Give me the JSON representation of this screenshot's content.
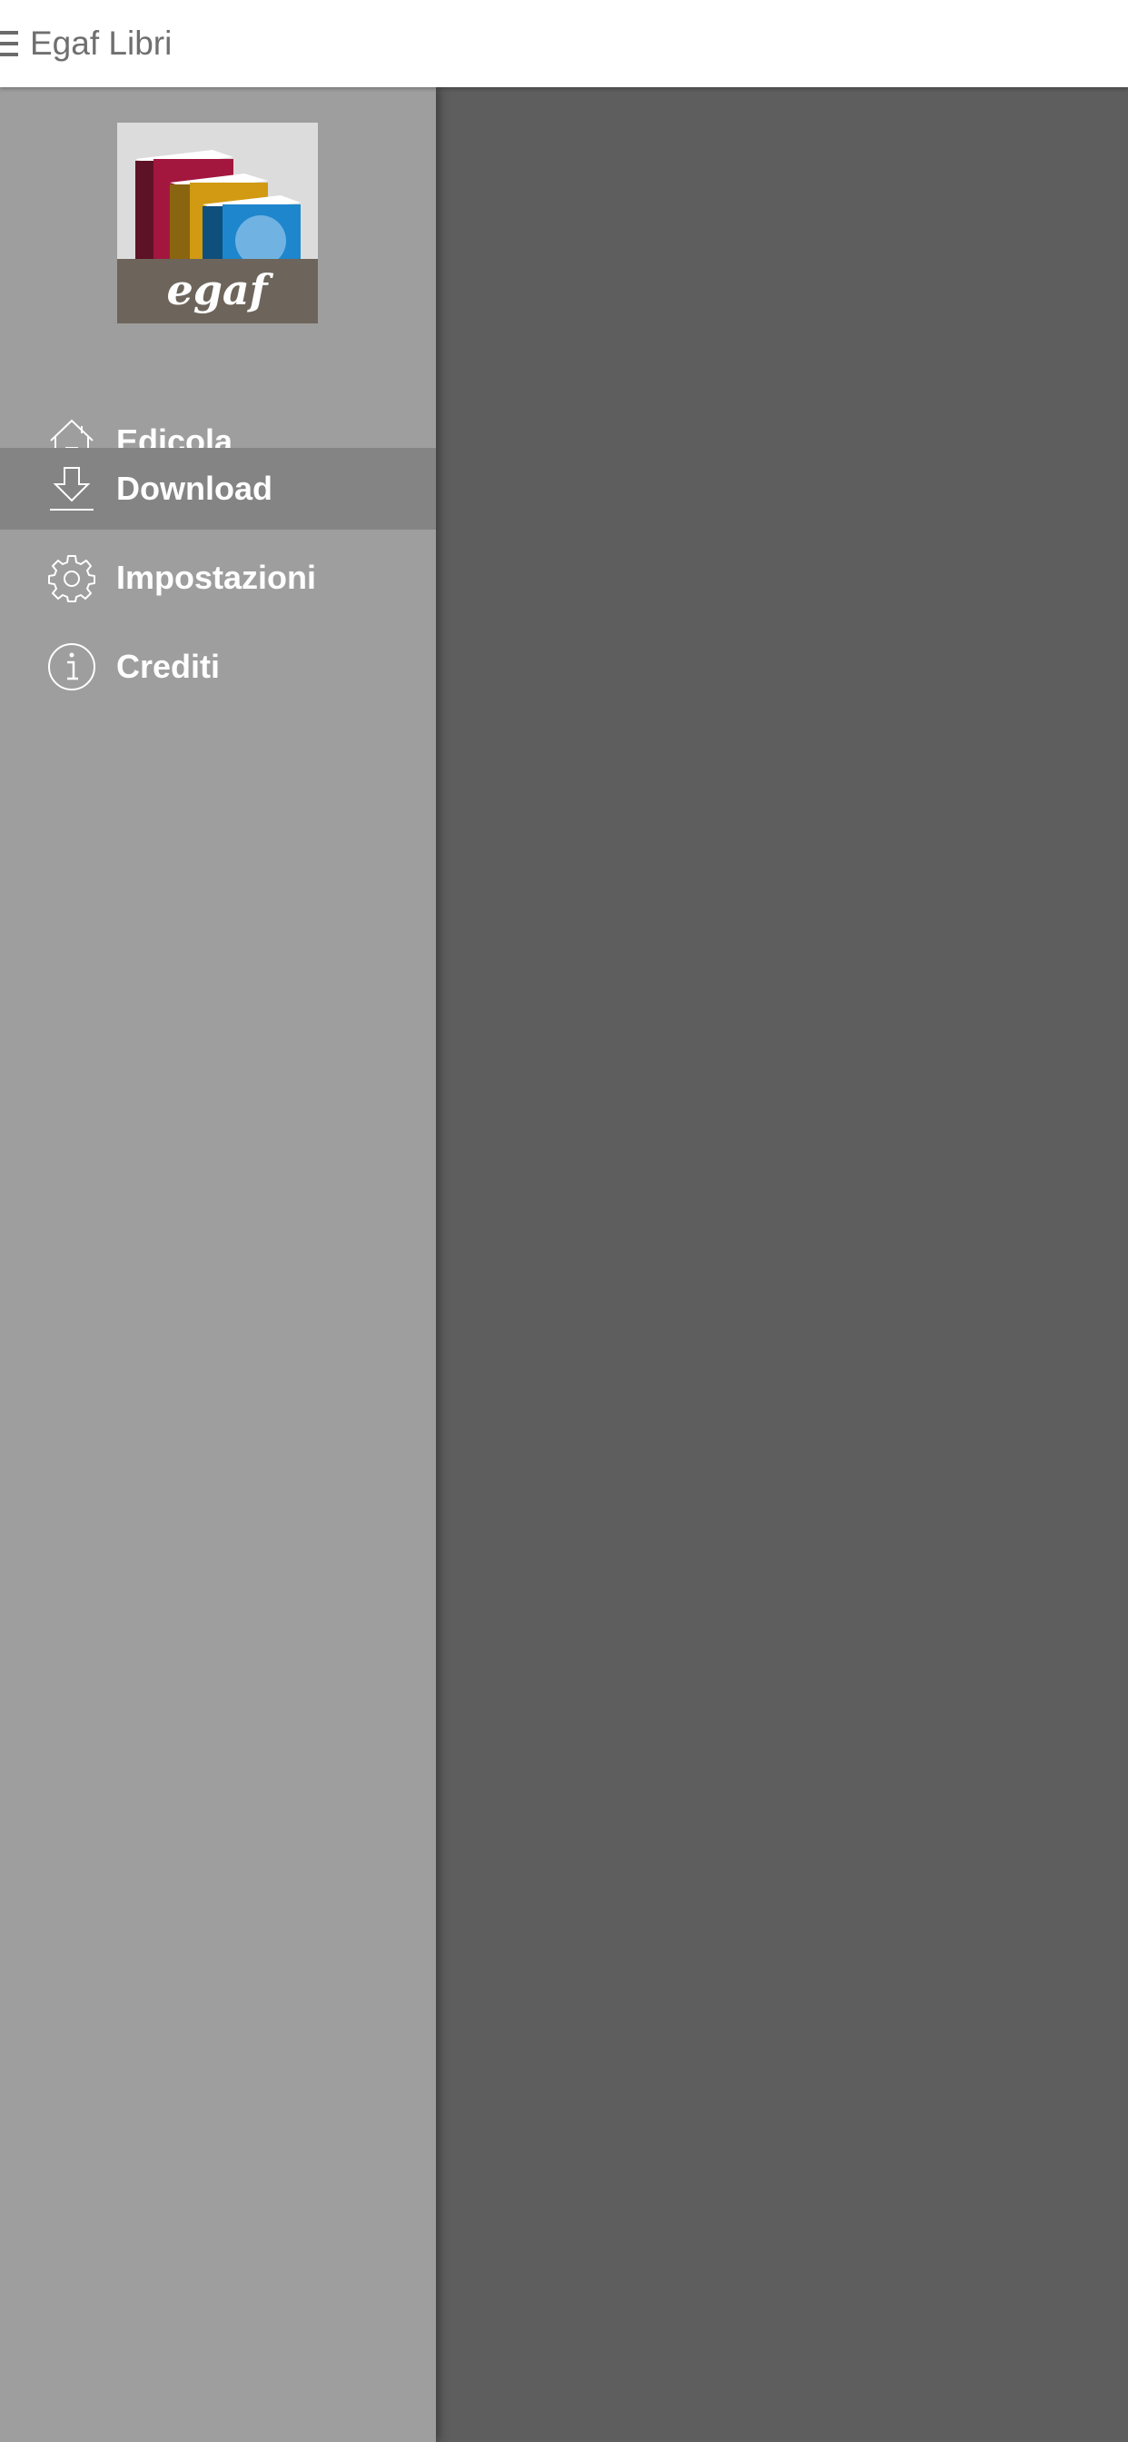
{
  "header": {
    "title": "Egaf Libri",
    "menu_icon": "hamburger-menu-icon"
  },
  "drawer": {
    "logo_text": "egaf",
    "items": [
      {
        "label": "Edicola",
        "icon": "home-icon",
        "active": false
      },
      {
        "label": "Download",
        "icon": "download-icon",
        "active": true
      },
      {
        "label": "Impostazioni",
        "icon": "gear-icon",
        "active": false
      },
      {
        "label": "Crediti",
        "icon": "info-icon",
        "active": false
      }
    ]
  },
  "colors": {
    "header_bg": "#ffffff",
    "drawer_bg": "#9e9e9e",
    "active_item_bg": "#848484",
    "overlay_bg": "#5e5e5e",
    "book_red": "#a3173f",
    "book_gold": "#d19a12",
    "book_blue": "#1e86cc",
    "logo_band": "#6d655b"
  }
}
